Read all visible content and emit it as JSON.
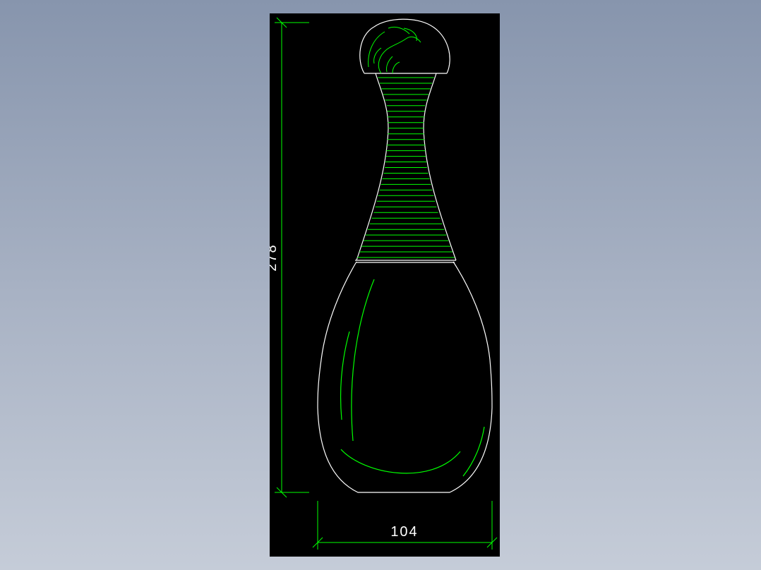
{
  "drawing": {
    "dimensions": {
      "height": "278",
      "width": "104"
    },
    "colors": {
      "background": "#000000",
      "outline": "#ffffff",
      "detail": "#00ff00",
      "dimension": "#00ff00",
      "text": "#ffffff"
    },
    "rib_count": 33
  }
}
